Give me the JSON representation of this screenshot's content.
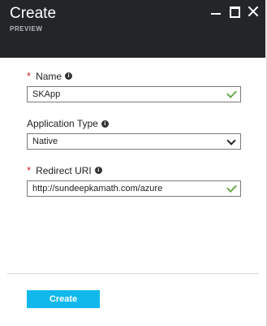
{
  "blade": {
    "title": "Create",
    "subtitle": "PREVIEW"
  },
  "form": {
    "name": {
      "label": "Name",
      "value": "SKApp",
      "required": true
    },
    "application_type": {
      "label": "Application Type",
      "value": "Native"
    },
    "redirect_uri": {
      "label": "Redirect URI",
      "value": "http://sundeepkamath.com/azure",
      "required": true
    },
    "required_marker": "*",
    "info_glyph": "i"
  },
  "actions": {
    "create_label": "Create"
  },
  "colors": {
    "header_bg": "#222629",
    "accent": "#10b8ec",
    "valid": "#6aa94a",
    "required": "#cc2222"
  },
  "icons": [
    "minimize-icon",
    "maximize-icon",
    "close-icon",
    "info-icon",
    "checkmark-icon",
    "chevron-down-icon"
  ]
}
